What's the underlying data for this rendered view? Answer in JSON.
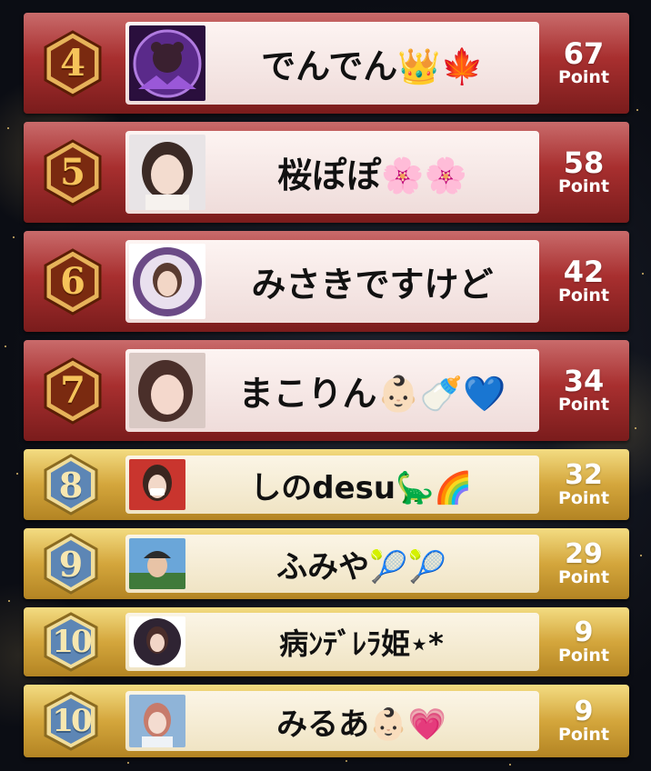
{
  "ranking": [
    {
      "rank": "4",
      "name": "でんでん👑🍁",
      "points": "67",
      "unit": "Point",
      "avatar": "avatar-purple-bear",
      "tier": "red"
    },
    {
      "rank": "5",
      "name": "桜ぽぽ🌸🌸",
      "points": "58",
      "unit": "Point",
      "avatar": "avatar-girl-light",
      "tier": "red"
    },
    {
      "rank": "6",
      "name": "みさきですけど",
      "points": "42",
      "unit": "Point",
      "avatar": "avatar-girl-frame",
      "tier": "red"
    },
    {
      "rank": "7",
      "name": "まこりん👶🏻🍼💙",
      "points": "34",
      "unit": "Point",
      "avatar": "avatar-girl-pink",
      "tier": "red"
    },
    {
      "rank": "8",
      "name": "しのdesu🦕🌈",
      "points": "32",
      "unit": "Point",
      "avatar": "avatar-girl-mask",
      "tier": "gold"
    },
    {
      "rank": "9",
      "name": "ふみや🎾🎾",
      "points": "29",
      "unit": "Point",
      "avatar": "avatar-boy-hat",
      "tier": "gold"
    },
    {
      "rank": "10",
      "name": "病ﾝﾃﾞﾚﾗ姫⋆*",
      "points": "9",
      "unit": "Point",
      "avatar": "avatar-girl-circle",
      "tier": "gold"
    },
    {
      "rank": "10",
      "name": "みるあ👶🏻💗",
      "points": "9",
      "unit": "Point",
      "avatar": "avatar-girl-blue",
      "tier": "gold"
    }
  ],
  "colors": {
    "red_tier": "#a82f2f",
    "gold_tier": "#d4a63c",
    "badge_red": "#7a2a10",
    "badge_gold": "#5d86b5"
  }
}
